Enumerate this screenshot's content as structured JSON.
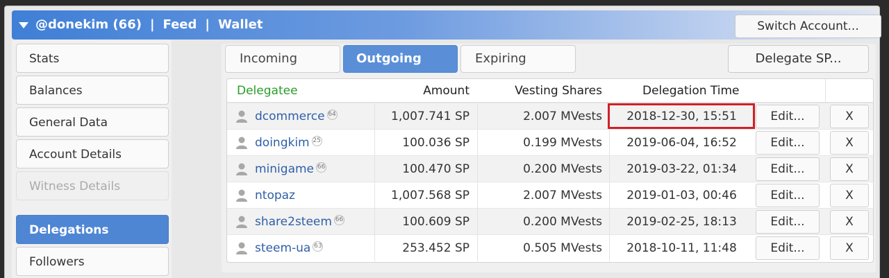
{
  "header": {
    "account": "@donekim (66)",
    "sep1": "|",
    "feed": "Feed",
    "sep2": "|",
    "wallet": "Wallet",
    "switch_label": "Switch Account..."
  },
  "sidebar": {
    "items": [
      {
        "label": "Stats"
      },
      {
        "label": "Balances"
      },
      {
        "label": "General Data"
      },
      {
        "label": "Account Details"
      },
      {
        "label": "Witness Details"
      },
      {
        "label": "Delegations"
      },
      {
        "label": "Followers"
      }
    ]
  },
  "tabs": [
    {
      "label": "Incoming"
    },
    {
      "label": "Outgoing"
    },
    {
      "label": "Expiring"
    }
  ],
  "delegate_label": "Delegate SP...",
  "table": {
    "headers": {
      "delegatee": "Delegatee",
      "amount": "Amount",
      "vesting": "Vesting Shares",
      "time": "Delegation Time"
    },
    "edit_label": "Edit...",
    "remove_label": "X",
    "rows": [
      {
        "name": "dcommerce",
        "rep": "64",
        "amount": "1,007.741 SP",
        "vests": "2.007 MVests",
        "time": "2018-12-30, 15:51"
      },
      {
        "name": "doingkim",
        "rep": "25",
        "amount": "100.036 SP",
        "vests": "0.199 MVests",
        "time": "2019-06-04, 16:52"
      },
      {
        "name": "minigame",
        "rep": "66",
        "amount": "100.470 SP",
        "vests": "0.200 MVests",
        "time": "2019-03-22, 01:34"
      },
      {
        "name": "ntopaz",
        "rep": "",
        "amount": "1,007.568 SP",
        "vests": "2.007 MVests",
        "time": "2019-01-03, 00:46"
      },
      {
        "name": "share2steem",
        "rep": "66",
        "amount": "100.609 SP",
        "vests": "0.200 MVests",
        "time": "2019-02-25, 18:13"
      },
      {
        "name": "steem-ua",
        "rep": "63",
        "amount": "253.452 SP",
        "vests": "0.505 MVests",
        "time": "2018-10-11, 11:48"
      }
    ]
  }
}
